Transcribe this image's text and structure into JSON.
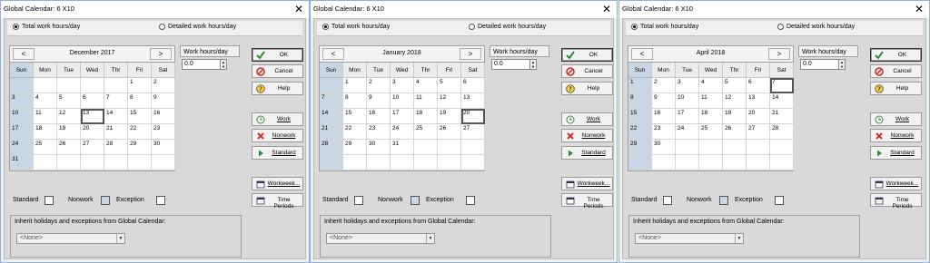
{
  "dialogs": [
    {
      "title": "Global Calendar: 6 X10",
      "radio_total": "Total work hours/day",
      "radio_detailed": "Detailed work hours/day",
      "selected_mode": "total",
      "prev_label": "<",
      "next_label": ">",
      "month_label": "December 2017",
      "weekdays": [
        "Sun",
        "Mon",
        "Tue",
        "Wed",
        "Thr",
        "Fri",
        "Sat"
      ],
      "weeks": [
        [
          "",
          "",
          "",
          "",
          "",
          "1",
          "2"
        ],
        [
          "3",
          "4",
          "5",
          "6",
          "7",
          "8",
          "9"
        ],
        [
          "10",
          "11",
          "12",
          "13",
          "14",
          "15",
          "16"
        ],
        [
          "17",
          "18",
          "19",
          "20",
          "21",
          "22",
          "23"
        ],
        [
          "24",
          "25",
          "26",
          "27",
          "28",
          "29",
          "30"
        ],
        [
          "31",
          "",
          "",
          "",
          "",
          "",
          ""
        ]
      ],
      "selected_day": "13",
      "work_hours_label": "Work hours/day",
      "work_hours_value": "0.0",
      "buttons": {
        "ok": "OK",
        "cancel": "Cancel",
        "help": "Help",
        "work": "Work",
        "nonwork": "Nonwork",
        "standard": "Standard",
        "workweek": "Workweek...",
        "time_periods": "Time Periods"
      },
      "legend": {
        "standard": "Standard",
        "nonwork": "Nonwork",
        "exception": "Exception"
      },
      "inherit_label": "Inherit holidays and exceptions from Global Calendar:",
      "inherit_value": "<None>"
    },
    {
      "title": "Global Calendar: 6 X10",
      "radio_total": "Total work hours/day",
      "radio_detailed": "Detailed work hours/day",
      "selected_mode": "total",
      "prev_label": "<",
      "next_label": ">",
      "month_label": "January 2018",
      "weekdays": [
        "Sun",
        "Mon",
        "Tue",
        "Wed",
        "Thr",
        "Fri",
        "Sat"
      ],
      "weeks": [
        [
          "",
          "1",
          "2",
          "3",
          "4",
          "5",
          "6"
        ],
        [
          "7",
          "8",
          "9",
          "10",
          "11",
          "12",
          "13"
        ],
        [
          "14",
          "15",
          "16",
          "17",
          "18",
          "19",
          "20"
        ],
        [
          "21",
          "22",
          "23",
          "24",
          "25",
          "26",
          "27"
        ],
        [
          "28",
          "29",
          "30",
          "31",
          "",
          "",
          ""
        ],
        [
          "",
          "",
          "",
          "",
          "",
          "",
          ""
        ]
      ],
      "selected_day": "20",
      "work_hours_label": "Work hours/day",
      "work_hours_value": "0.0",
      "buttons": {
        "ok": "OK",
        "cancel": "Cancel",
        "help": "Help",
        "work": "Work",
        "nonwork": "Nonwork",
        "standard": "Standard",
        "workweek": "Workweek...",
        "time_periods": "Time Periods"
      },
      "legend": {
        "standard": "Standard",
        "nonwork": "Nonwork",
        "exception": "Exception"
      },
      "inherit_label": "Inherit holidays and exceptions from Global Calendar:",
      "inherit_value": "<None>"
    },
    {
      "title": "Global Calendar: 6 X10",
      "radio_total": "Total work hours/day",
      "radio_detailed": "Detailed work hours/day",
      "selected_mode": "total",
      "prev_label": "<",
      "next_label": ">",
      "month_label": "April 2018",
      "weekdays": [
        "Sun",
        "Mon",
        "Tue",
        "Wed",
        "Thr",
        "Fri",
        "Sat"
      ],
      "weeks": [
        [
          "1",
          "2",
          "3",
          "4",
          "5",
          "6",
          "7"
        ],
        [
          "8",
          "9",
          "10",
          "11",
          "12",
          "13",
          "14"
        ],
        [
          "15",
          "16",
          "17",
          "18",
          "19",
          "20",
          "21"
        ],
        [
          "22",
          "23",
          "24",
          "25",
          "26",
          "27",
          "28"
        ],
        [
          "29",
          "30",
          "",
          "",
          "",
          "",
          ""
        ],
        [
          "",
          "",
          "",
          "",
          "",
          "",
          ""
        ]
      ],
      "selected_day": "7",
      "work_hours_label": "Work hours/day",
      "work_hours_value": "0.0",
      "buttons": {
        "ok": "OK",
        "cancel": "Cancel",
        "help": "Help",
        "work": "Work",
        "nonwork": "Nonwork",
        "standard": "Standard",
        "workweek": "Workweek...",
        "time_periods": "Time Periods"
      },
      "legend": {
        "standard": "Standard",
        "nonwork": "Nonwork",
        "exception": "Exception"
      },
      "inherit_label": "Inherit holidays and exceptions from Global Calendar:",
      "inherit_value": "<None>"
    }
  ],
  "colors": {
    "sunday_shade": "#c9d6e3",
    "dialog_bg": "#f0f0f0",
    "body_bg": "#d9d9d9",
    "ok_icon": "#2e8b3a",
    "cancel_icon": "#d0302a",
    "nonwork_icon": "#d0302a"
  }
}
